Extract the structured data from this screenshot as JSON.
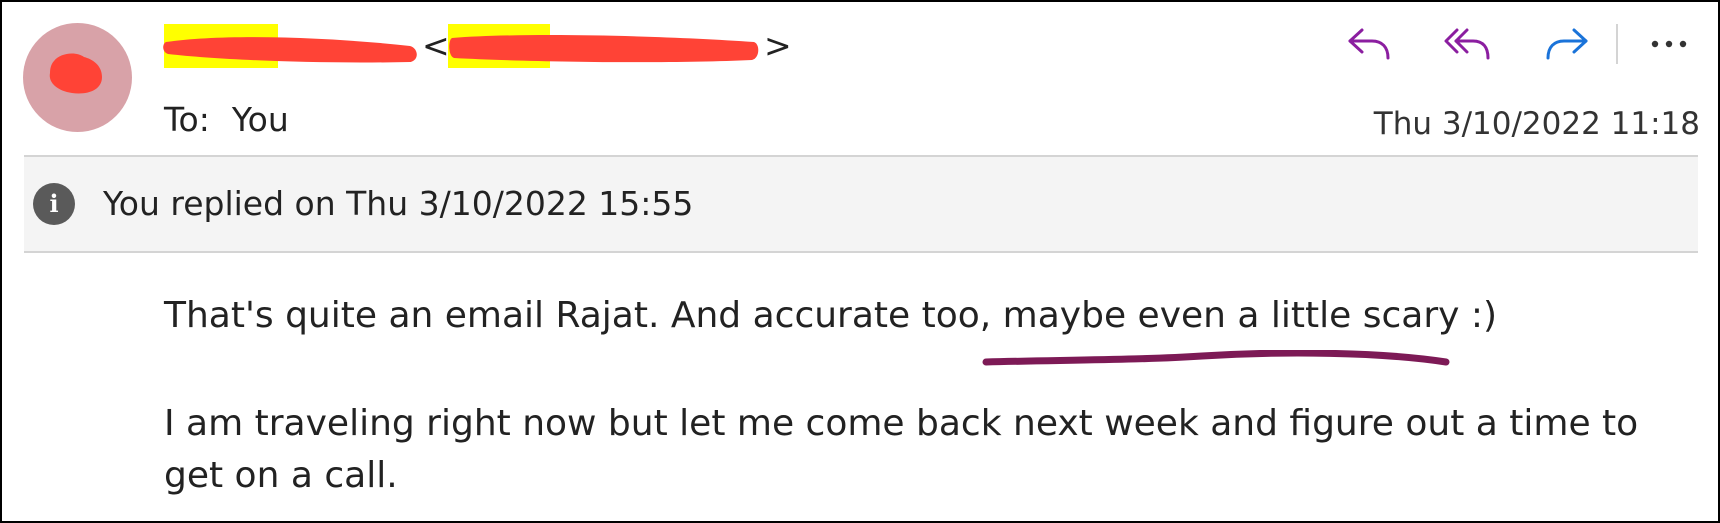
{
  "email": {
    "sender_prefix": "",
    "sender_open": "<",
    "sender_close": ">",
    "to_label": "To:",
    "to_value": "You",
    "date": "Thu 3/10/2022 11:18",
    "info": "You replied on Thu 3/10/2022 15:55",
    "body": {
      "p1_a": "That's quite an email Rajat. And accurate too, ",
      "p1_b": "maybe even a little scary",
      "p1_c": " :)",
      "p2": "I am traveling right now but let me come back next week and figure out a time to get on a call."
    }
  },
  "toolbar": {
    "actions": [
      "reply-icon",
      "reply-all-icon",
      "forward-icon",
      "more-icon"
    ]
  },
  "colors": {
    "reply": "#8b1ea0",
    "forward": "#1a73d9",
    "redaction": "#ff4336",
    "highlight": "#ffff00",
    "annotation": "#7d1a56",
    "avatar": "#d8a2a8",
    "infobar": "#f4f4f4"
  }
}
